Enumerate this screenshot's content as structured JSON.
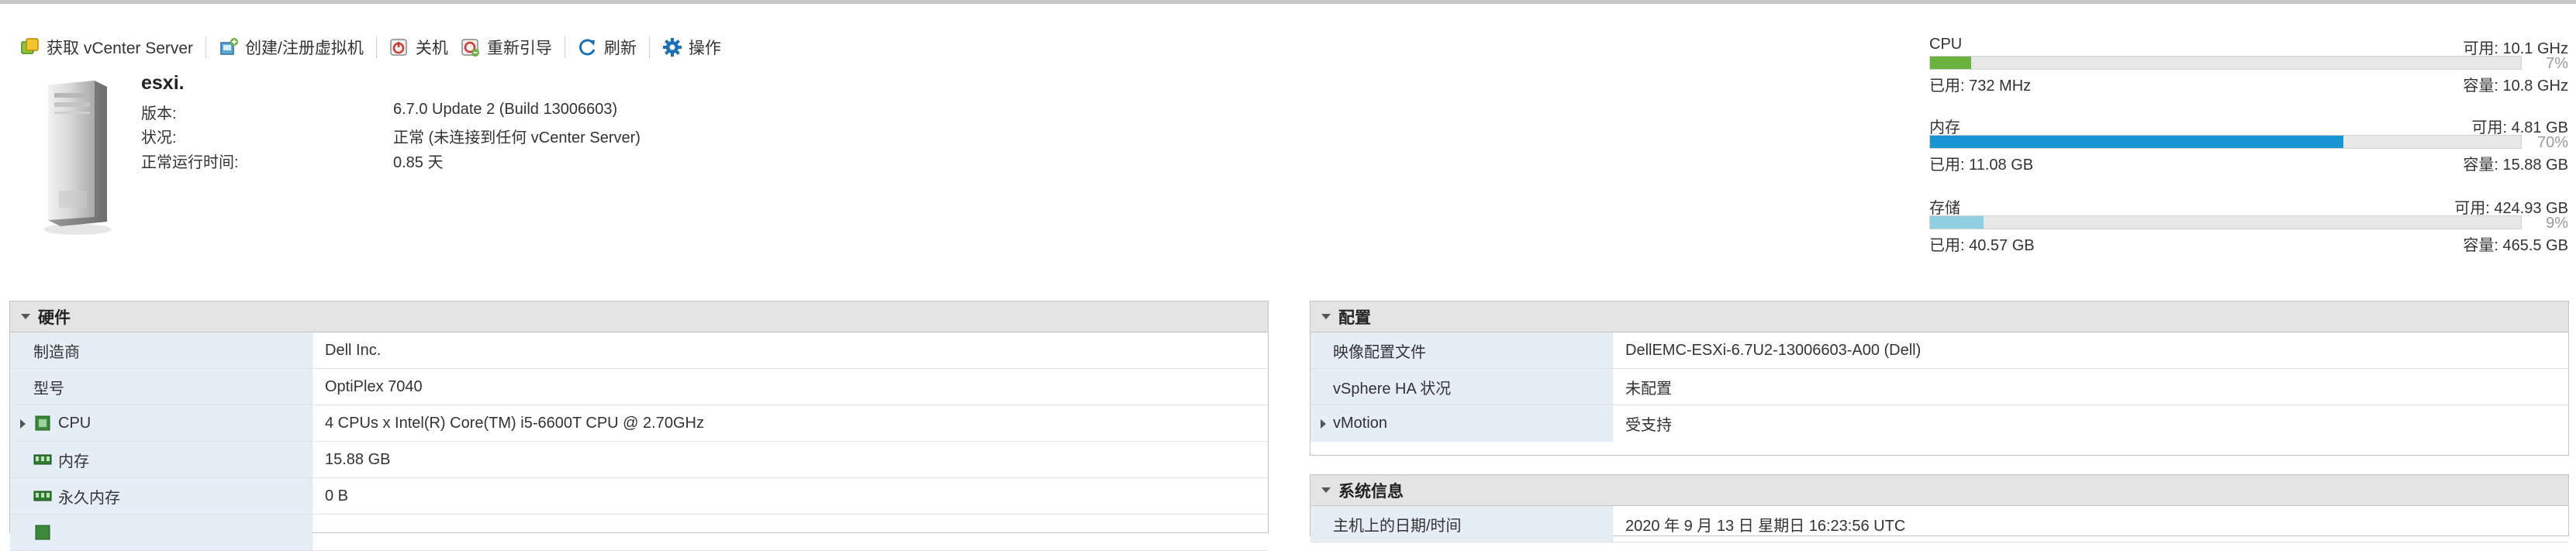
{
  "toolbar": {
    "get_vcenter": "获取 vCenter Server",
    "create_vm": "创建/注册虚拟机",
    "shutdown": "关机",
    "reboot": "重新引导",
    "refresh": "刷新",
    "actions": "操作"
  },
  "host": {
    "name": "esxi.",
    "version_label": "版本:",
    "version_value": "6.7.0 Update 2 (Build 13006603)",
    "state_label": "状况:",
    "state_value": "正常 (未连接到任何 vCenter Server)",
    "uptime_label": "正常运行时间:",
    "uptime_value": "0.85 天"
  },
  "resources": {
    "cpu": {
      "name": "CPU",
      "free": "可用: 10.1 GHz",
      "percent": "7%",
      "fraction": 0.07,
      "used": "已用: 732 MHz",
      "capacity": "容量: 10.8 GHz",
      "color": "#6cb23e"
    },
    "memory": {
      "name": "内存",
      "free": "可用: 4.81 GB",
      "percent": "70%",
      "fraction": 0.7,
      "used": "已用: 11.08 GB",
      "capacity": "容量: 15.88 GB",
      "color": "#1a95d3"
    },
    "storage": {
      "name": "存储",
      "free": "可用: 424.93 GB",
      "percent": "9%",
      "fraction": 0.09,
      "used": "已用: 40.57 GB",
      "capacity": "容量: 465.5 GB",
      "color": "#8ed0e2"
    }
  },
  "hardware": {
    "title": "硬件",
    "rows": [
      {
        "label": "制造商",
        "value": "Dell Inc."
      },
      {
        "label": "型号",
        "value": "OptiPlex 7040"
      },
      {
        "label": "CPU",
        "value": "4 CPUs x Intel(R) Core(TM) i5-6600T CPU @ 2.70GHz"
      },
      {
        "label": "内存",
        "value": "15.88 GB"
      },
      {
        "label": "永久内存",
        "value": "0 B"
      }
    ]
  },
  "configuration": {
    "title": "配置",
    "rows": [
      {
        "label": "映像配置文件",
        "value": "DellEMC-ESXi-6.7U2-13006603-A00 (Dell)"
      },
      {
        "label": "vSphere HA 状况",
        "value": "未配置"
      },
      {
        "label": "vMotion",
        "value": "受支持"
      }
    ]
  },
  "system_info": {
    "title": "系统信息",
    "rows": [
      {
        "label": "主机上的日期/时间",
        "value": "2020 年 9 月 13 日 星期日 16:23:56 UTC"
      }
    ]
  }
}
